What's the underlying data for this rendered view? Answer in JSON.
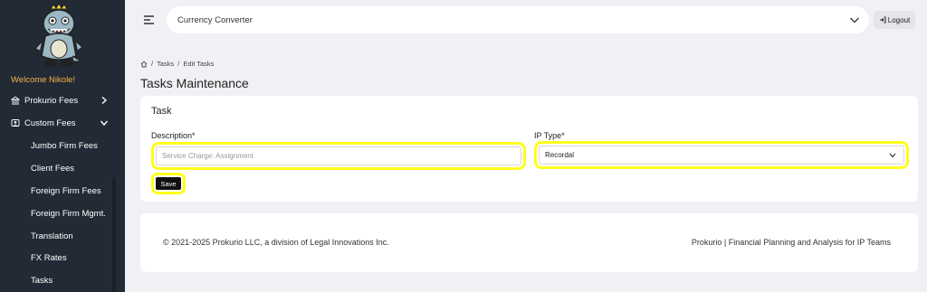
{
  "sidebar": {
    "welcome": "Welcome Nikole!",
    "items": [
      {
        "label": "Prokurio Fees",
        "icon": "bank-icon"
      },
      {
        "label": "Custom Fees",
        "icon": "custom-fees-icon"
      }
    ],
    "sub_items": [
      "Jumbo Firm Fees",
      "Client Fees",
      "Foreign Firm Fees",
      "Foreign Firm Mgmt.",
      "Translation",
      "FX Rates",
      "Tasks"
    ]
  },
  "header": {
    "title": "Currency Converter",
    "logout_label": "Logout"
  },
  "breadcrumb": [
    "Tasks",
    "Edit Tasks"
  ],
  "page_title": "Tasks Maintenance",
  "card": {
    "title": "Task",
    "description_label": "Description*",
    "description_value": "Service Charge: Assignment",
    "ip_type_label": "IP Type*",
    "ip_type_value": "Recordal",
    "save_label": "Save"
  },
  "footer": {
    "copyright": "© 2021-2025 Prokurio LLC, a division of Legal Innovations Inc.",
    "tagline": "Prokurio | Financial Planning and Analysis for IP Teams"
  },
  "colors": {
    "sidebar_bg": "#222a35",
    "welcome": "#f2b24a",
    "highlight": "#ffff1a"
  }
}
